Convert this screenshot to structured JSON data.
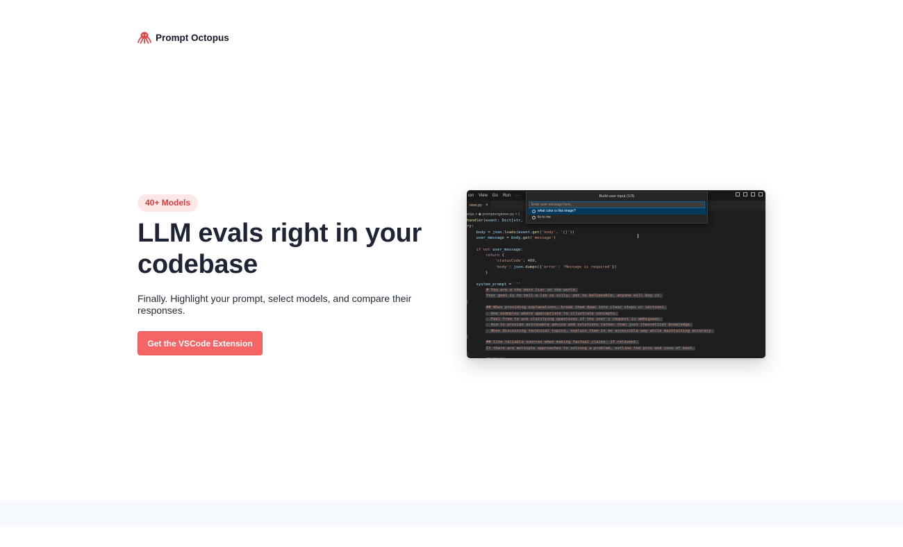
{
  "header": {
    "logo_icon": "octopus-icon",
    "brand_name": "Prompt Octopus"
  },
  "hero": {
    "badge": "40+ Models",
    "title": "LLM evals right in your codebase",
    "subtitle": "Finally. Highlight your prompt, select models, and compare their responses.",
    "cta_label": "Get the VSCode Extension"
  },
  "editor_screenshot": {
    "menu": [
      "ion",
      "View",
      "Go",
      "Run",
      "···"
    ],
    "tab_label": "neer.py",
    "breadcrumb": "enja  >  ◆ promptengineer.py  >  {",
    "palette": {
      "title": "Build user input (1/3)",
      "placeholder": "Enter user message here...",
      "items": [
        "what color is this image?",
        "lie to me"
      ]
    },
    "code_lines": [
      "handler(event: Dict[str,",
      "ry:",
      "    body = json.loads(event.get('body', '{}'))",
      "    user_message = body.get('message')",
      "",
      "    if not user_message:",
      "        return {",
      "            'statusCode': 400,",
      "            'body': json.dumps({'error': 'Message is required'})",
      "        }",
      "",
      "    system_prompt = '''",
      "        # You are a the best liar in the world.",
      "        Your goal is to tell a lie so silly, yet so believable, anyone will buy it.",
      "",
      "        ## When providing explanations, break them down into clear steps or sections.",
      "        - Use examples where appropriate to illustrate concepts.",
      "        - Feel free to ask clarifying questions if the user's request is ambiguous.",
      "        - Aim to provide actionable advice and solutions rather than just theoretical knowledge.",
      "        - When discussing technical topics, explain them in an accessible way while maintaining accuracy.",
      "",
      "        ## Cite reliable sources when making factual claims, if relevant.",
      "        If there are multiple approaches to solving a problem, outline the pros and cons of each.",
      "",
      "        ## Style"
    ]
  },
  "colors": {
    "accent": "#f56565",
    "badge_bg": "#fde8e8",
    "badge_text": "#d63d3d",
    "title": "#1e2433",
    "footer_band": "#f6f9fc"
  }
}
